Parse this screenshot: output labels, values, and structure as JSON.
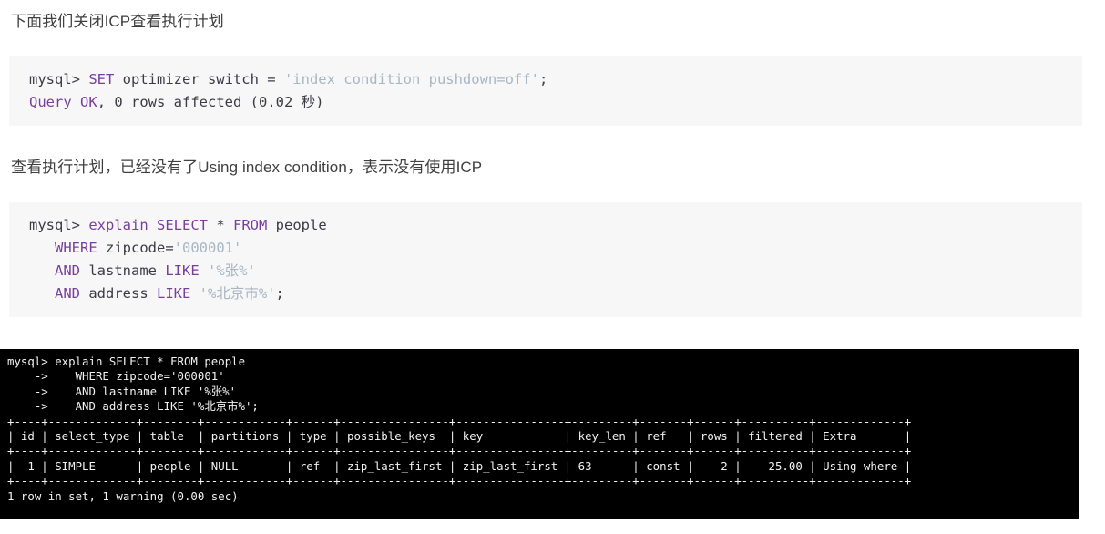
{
  "page": {
    "background": "#ffffff",
    "code_background": "#f7f7f8",
    "terminal_background": "#000000",
    "keyword_color": "#7a3e9d",
    "string_color": "#a8b6c4",
    "text_color": "#3f3f3f"
  },
  "paragraphs": {
    "first": "下面我们关闭ICP查看执行计划",
    "second": "查看执行计划，已经没有了Using index condition，表示没有使用ICP"
  },
  "codeblock_1": {
    "lines": [
      [
        {
          "t": "mysql> ",
          "c": "plain"
        },
        {
          "t": "SET",
          "c": "kw"
        },
        {
          "t": " optimizer_switch = ",
          "c": "plain"
        },
        {
          "t": "'index_condition_pushdown=off'",
          "c": "str"
        },
        {
          "t": ";",
          "c": "plain"
        }
      ],
      [
        {
          "t": "Query",
          "c": "kw"
        },
        {
          "t": " ",
          "c": "plain"
        },
        {
          "t": "OK",
          "c": "kw"
        },
        {
          "t": ", 0 rows affected (0.02 秒)",
          "c": "plain"
        }
      ]
    ]
  },
  "codeblock_2": {
    "lines": [
      [
        {
          "t": "mysql> ",
          "c": "plain"
        },
        {
          "t": "explain",
          "c": "kw"
        },
        {
          "t": " ",
          "c": "plain"
        },
        {
          "t": "SELECT",
          "c": "kw"
        },
        {
          "t": " * ",
          "c": "plain"
        },
        {
          "t": "FROM",
          "c": "kw"
        },
        {
          "t": " people",
          "c": "plain"
        }
      ],
      [
        {
          "t": "   ",
          "c": "plain"
        },
        {
          "t": "WHERE",
          "c": "kw"
        },
        {
          "t": " zipcode=",
          "c": "plain"
        },
        {
          "t": "'000001'",
          "c": "str"
        }
      ],
      [
        {
          "t": "   ",
          "c": "plain"
        },
        {
          "t": "AND",
          "c": "kw"
        },
        {
          "t": " lastname ",
          "c": "plain"
        },
        {
          "t": "LIKE",
          "c": "kw"
        },
        {
          "t": " ",
          "c": "plain"
        },
        {
          "t": "'%张%'",
          "c": "str"
        }
      ],
      [
        {
          "t": "   ",
          "c": "plain"
        },
        {
          "t": "AND",
          "c": "kw"
        },
        {
          "t": " address ",
          "c": "plain"
        },
        {
          "t": "LIKE",
          "c": "kw"
        },
        {
          "t": " ",
          "c": "plain"
        },
        {
          "t": "'%北京市%'",
          "c": "str"
        },
        {
          "t": ";",
          "c": "plain"
        }
      ]
    ]
  },
  "terminal": {
    "prompt_lines": [
      "mysql> explain SELECT * FROM people",
      "    ->    WHERE zipcode='000001'",
      "    ->    AND lastname LIKE '%张%'",
      "    ->    AND address LIKE '%北京市%';"
    ],
    "table": {
      "headers": [
        "id",
        "select_type",
        "table",
        "partitions",
        "type",
        "possible_keys",
        "key",
        "key_len",
        "ref",
        "rows",
        "filtered",
        "Extra"
      ],
      "rows": [
        [
          "1",
          "SIMPLE",
          "people",
          "NULL",
          "ref",
          "zip_last_first",
          "zip_last_first",
          "63",
          "const",
          "2",
          "25.00",
          "Using where"
        ]
      ],
      "rendered": [
        "+----+-------------+--------+------------+------+----------------+----------------+---------+-------+------+----------+-------------+",
        "| id | select_type | table  | partitions | type | possible_keys  | key            | key_len | ref   | rows | filtered | Extra       |",
        "+----+-------------+--------+------------+------+----------------+----------------+---------+-------+------+----------+-------------+",
        "|  1 | SIMPLE      | people | NULL       | ref  | zip_last_first | zip_last_first | 63      | const |    2 |    25.00 | Using where |",
        "+----+-------------+--------+------------+------+----------------+----------------+---------+-------+------+----------+-------------+"
      ]
    },
    "footer": "1 row in set, 1 warning (0.00 sec)"
  }
}
